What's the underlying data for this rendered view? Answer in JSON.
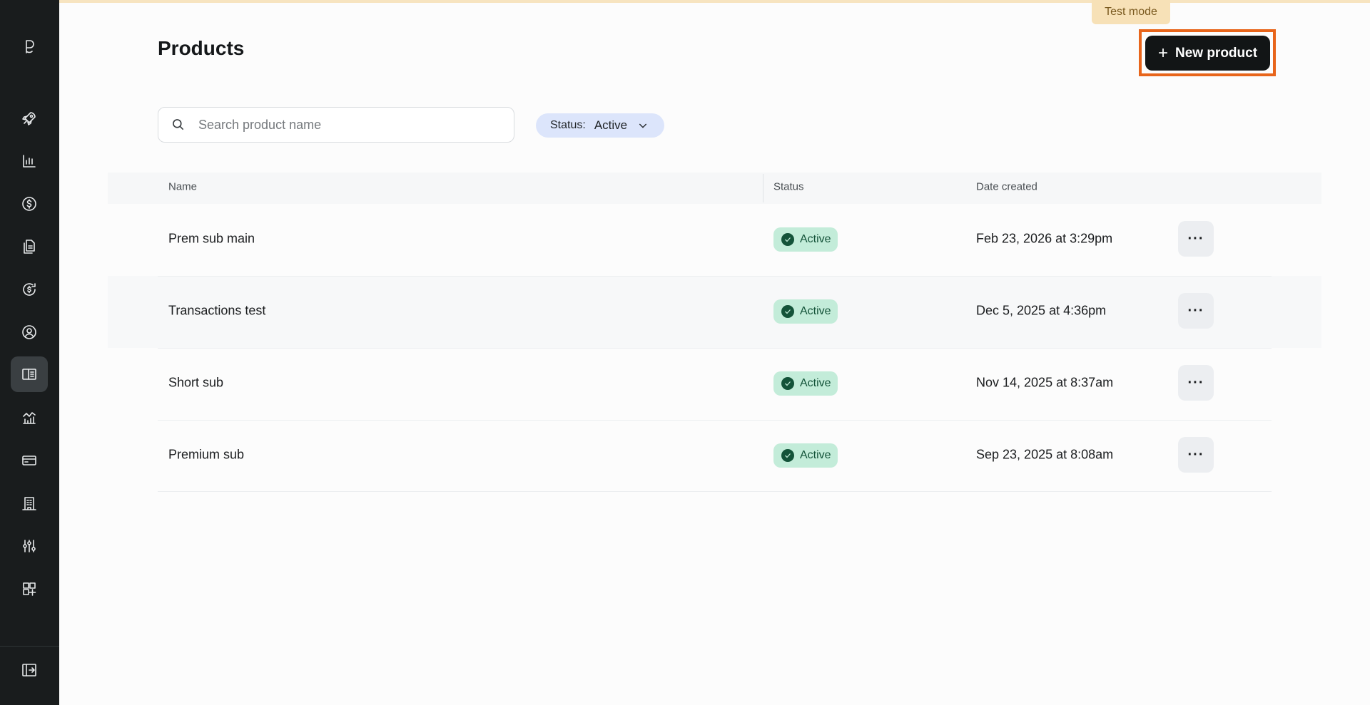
{
  "app": {
    "test_mode_label": "Test mode"
  },
  "sidebar": {
    "logo_icon": "polar-logo-icon",
    "items": [
      {
        "icon": "rocket-icon",
        "active": false
      },
      {
        "icon": "bar-chart-icon",
        "active": false
      },
      {
        "icon": "dollar-circle-icon",
        "active": false
      },
      {
        "icon": "documents-icon",
        "active": false
      },
      {
        "icon": "subscription-refresh-icon",
        "active": false
      },
      {
        "icon": "user-circle-icon",
        "active": false
      },
      {
        "icon": "product-catalog-icon",
        "active": true
      },
      {
        "icon": "analytics-icon",
        "active": false
      },
      {
        "icon": "credit-card-icon",
        "active": false
      },
      {
        "icon": "building-icon",
        "active": false
      },
      {
        "icon": "sliders-icon",
        "active": false
      },
      {
        "icon": "add-widget-icon",
        "active": false
      }
    ],
    "collapse_icon": "collapse-sidebar-icon"
  },
  "header": {
    "title": "Products",
    "new_product_label": "New product"
  },
  "search": {
    "placeholder": "Search product name",
    "value": ""
  },
  "filter": {
    "label": "Status:",
    "value": "Active"
  },
  "table": {
    "columns": [
      "Name",
      "Status",
      "Date created"
    ],
    "rows": [
      {
        "name": "Prem sub main",
        "status": "Active",
        "date": "Feb 23, 2026 at 3:29pm"
      },
      {
        "name": "Transactions test",
        "status": "Active",
        "date": "Dec 5, 2025 at 4:36pm"
      },
      {
        "name": "Short sub",
        "status": "Active",
        "date": "Nov 14, 2025 at 8:37am"
      },
      {
        "name": "Premium sub",
        "status": "Active",
        "date": "Sep 23, 2025 at 8:08am"
      }
    ],
    "more_label": "···"
  },
  "colors": {
    "sidebar_bg": "#191c1d",
    "accent_highlight": "#e8651b",
    "status_active_bg": "#c3ecd9",
    "status_active_fg": "#145339",
    "filter_bg": "#dce5fb",
    "test_mode_bg": "#f7e1b7"
  }
}
